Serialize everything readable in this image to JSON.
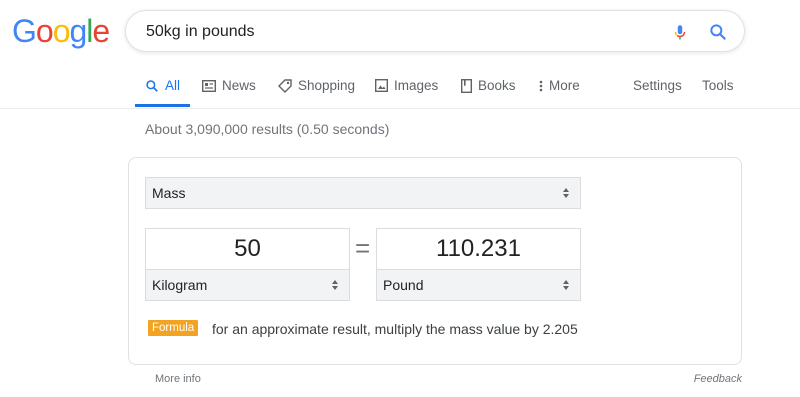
{
  "logo": {
    "letters": [
      "G",
      "o",
      "o",
      "g",
      "l",
      "e"
    ],
    "colors": [
      "#4285F4",
      "#EA4335",
      "#FBBC05",
      "#4285F4",
      "#34A853",
      "#EA4335"
    ]
  },
  "search": {
    "query": "50kg in pounds"
  },
  "tabs": [
    {
      "label": "All",
      "icon": "search-icon"
    },
    {
      "label": "News",
      "icon": "news-icon"
    },
    {
      "label": "Shopping",
      "icon": "tag-icon"
    },
    {
      "label": "Images",
      "icon": "image-icon"
    },
    {
      "label": "Books",
      "icon": "book-icon"
    },
    {
      "label": "More",
      "icon": "more-vert-icon"
    },
    {
      "label": "Settings"
    },
    {
      "label": "Tools"
    }
  ],
  "results_stats": "About 3,090,000 results (0.50 seconds)",
  "converter": {
    "category": "Mass",
    "from_value": "50",
    "to_value": "110.231",
    "from_unit": "Kilogram",
    "to_unit": "Pound",
    "equals": "=",
    "formula_label": "Formula",
    "formula_text": "for an approximate result, multiply the mass value by 2.205"
  },
  "footer": {
    "more_info": "More info",
    "feedback": "Feedback"
  },
  "colors": {
    "accent": "#1a73e8",
    "formula_badge": "#f2a322"
  }
}
